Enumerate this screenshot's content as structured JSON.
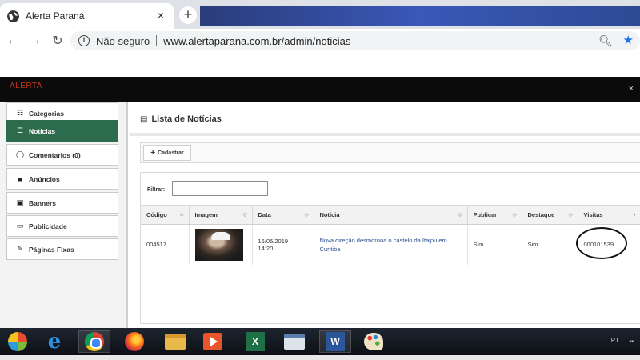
{
  "browser": {
    "tab_title": "Alerta Paraná",
    "tab_close": "×",
    "newtab": "+",
    "security_label": "Não seguro",
    "url": "www.alertaparana.com.br/admin/noticias"
  },
  "app": {
    "brand": "ALERTA",
    "close_label": "×"
  },
  "sidebar": {
    "items": [
      {
        "label": "Categorias",
        "icon": "sitemap-icon",
        "active": false
      },
      {
        "label": "Notícias",
        "icon": "list-icon",
        "active": true
      },
      {
        "label": "Comentarios (0)",
        "icon": "comment-icon",
        "active": false
      },
      {
        "label": "Anúncios",
        "icon": "video-icon",
        "active": false
      },
      {
        "label": "Banners",
        "icon": "image-icon",
        "active": false
      },
      {
        "label": "Publicidade",
        "icon": "monitor-icon",
        "active": false
      },
      {
        "label": "Páginas Fixas",
        "icon": "edit-icon",
        "active": false
      }
    ]
  },
  "main": {
    "title": "Lista de Notícias",
    "add_button": "Cadastrar",
    "filter_label": "Filtrar:",
    "filter_value": "",
    "columns": [
      "Código",
      "Imagem",
      "Data",
      "Notícia",
      "Publicar",
      "Destaque",
      "Visitas"
    ],
    "rows": [
      {
        "codigo": "004517",
        "data_date": "16/05/2019",
        "data_time": "14:20",
        "noticia": "Nova direção desmorona o castelo da Itaipu em Curitiba",
        "publicar": "Sim",
        "destaque": "Sim",
        "visitas": "000101539"
      }
    ]
  },
  "taskbar": {
    "items": [
      "start-orb",
      "internet-explorer",
      "chrome",
      "firefox",
      "file-explorer",
      "media-player",
      "excel",
      "outlook",
      "word",
      "paint"
    ],
    "lang": "PT"
  }
}
